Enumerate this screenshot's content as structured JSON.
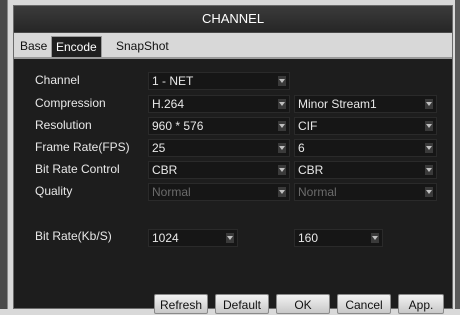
{
  "window": {
    "title": "CHANNEL"
  },
  "tabs": [
    {
      "label": "Base"
    },
    {
      "label": "Encode"
    },
    {
      "label": "SnapShot"
    }
  ],
  "labels": {
    "channel": "Channel",
    "compression": "Compression",
    "resolution": "Resolution",
    "frame_rate": "Frame Rate(FPS)",
    "bit_rate_control": "Bit Rate Control",
    "quality": "Quality",
    "bit_rate": "Bit Rate(Kb/S)"
  },
  "main_stream": {
    "channel": "1 - NET",
    "compression": "H.264",
    "resolution": "960 * 576",
    "frame_rate": "25",
    "bit_rate_control": "CBR",
    "quality": "Normal",
    "bit_rate": "1024"
  },
  "sub_stream": {
    "stream": "Minor Stream1",
    "resolution": "CIF",
    "frame_rate": "6",
    "bit_rate_control": "CBR",
    "quality": "Normal",
    "bit_rate": "160"
  },
  "buttons": {
    "refresh": "Refresh",
    "default": "Default",
    "ok": "OK",
    "cancel": "Cancel",
    "apply": "App."
  }
}
